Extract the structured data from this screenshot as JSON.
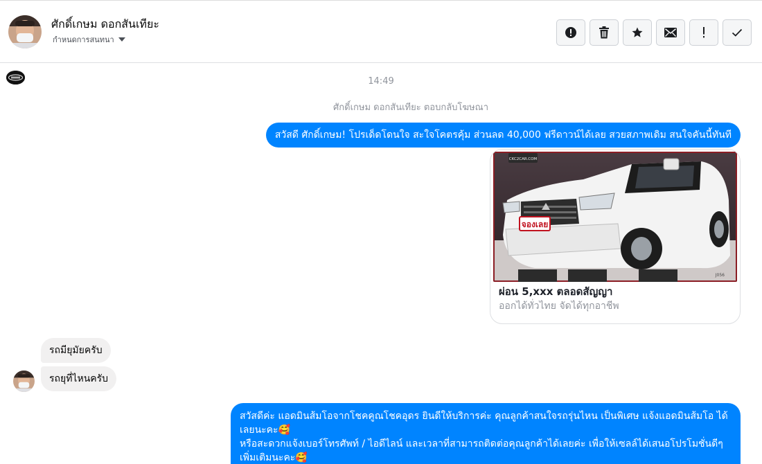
{
  "header": {
    "contact_name": "ศักดิ์เกษม ดอกสันเทียะ",
    "subtitle": "กำหนดการสนทนา",
    "actions": [
      {
        "name": "alert-icon"
      },
      {
        "name": "trash-icon"
      },
      {
        "name": "star-icon"
      },
      {
        "name": "envelope-icon"
      },
      {
        "name": "exclamation-icon"
      },
      {
        "name": "checkmark-icon"
      }
    ]
  },
  "chat": {
    "timestamp": "14:49",
    "system_note": "ศักดิ์เกษม ดอกสันเทียะ ตอบกลับโฆษณา",
    "outgoing_1": "สวัสดี ศักดิ์เกษม! โปรเด็ดโดนใจ สะใจโคตรคุ้ม ส่วนลด 40,000 ฟรีดาวน์ได้เลย สวยสภาพเดิม สนใจคันนี้ทันที",
    "card": {
      "image_banner": "จองเลย",
      "image_logo": "CKC2CAR.COM",
      "image_corner": "J056",
      "title": "ผ่อน 5,xxx ตลอดสัญญา",
      "subtitle": "ออกได้ทั่วไทย จัดได้ทุกอาชีพ"
    },
    "incoming_1": "รถมียุมัยครับ",
    "incoming_2": "รถยุที่ไหนครับ",
    "outgoing_2": {
      "line1": "สวัสดีค่ะ แอดมินส้มโอจากโชคคูณโชคอุดร ยินดีให้บริการค่ะ   คุณลูกค้าสนใจรถรุ่นไหน เป็นพิเศษ แจ้งแอดมินส้มโอ ได้เลยนะคะ🥰",
      "line2": "หรือสะดวกแจ้งเบอร์โทรศัพท์ / ไอดีไลน์ และเวลาที่สามารถติดต่อคุณลูกค้าได้เลยค่ะ เพื่อให้เซลล์ได้เสนอโปรโมชั่นดีๆเพิ่มเติมนะคะ🥰"
    }
  },
  "colors": {
    "accent": "#0084ff",
    "incoming_bubble": "#f1f0f0",
    "muted_text": "#90949c"
  }
}
